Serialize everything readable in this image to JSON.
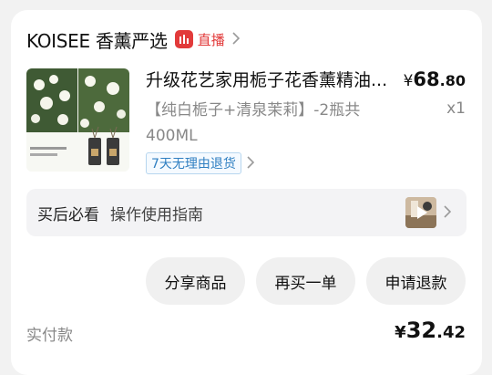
{
  "shop": {
    "name": "KOISEE 香薰严选",
    "live_label": "直播"
  },
  "product": {
    "title": "升级花艺家用栀子花香薰精油...",
    "variant_line1": "【纯白栀子+清泉茉莉】-2瓶共",
    "variant_line2": "400ML",
    "price_symbol": "¥",
    "price_int": "68",
    "price_dec": ".80",
    "quantity": "x1",
    "return_policy": "7天无理由退货"
  },
  "guide": {
    "label": "买后必看",
    "text": "操作使用指南"
  },
  "actions": {
    "share": "分享商品",
    "rebuy": "再买一单",
    "refund": "申请退款"
  },
  "payment": {
    "label": "实付款",
    "symbol": "¥",
    "int": "32",
    "dec": ".42"
  },
  "colors": {
    "live": "#e23a3a",
    "return_text": "#2f7fc1",
    "return_border": "#b7d6ef"
  },
  "icons": [
    "live-icon",
    "chevron-right-icon",
    "play-icon"
  ]
}
